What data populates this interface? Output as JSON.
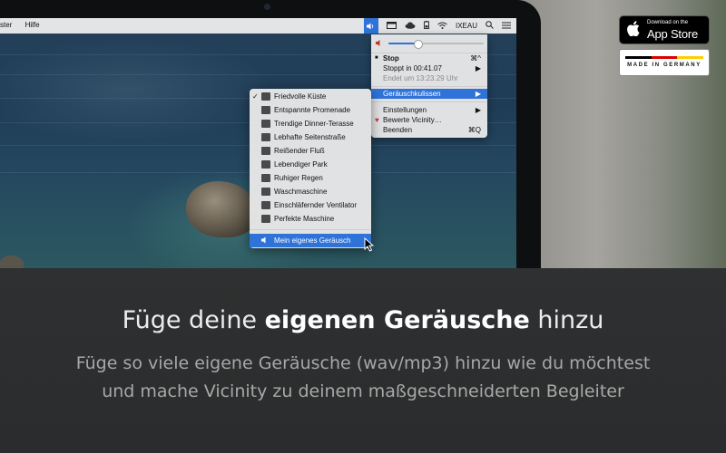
{
  "menubar": {
    "left_items": [
      "ster",
      "Hilfe"
    ],
    "account_label": "IXEAU"
  },
  "app_menu": {
    "volume_percent": 30,
    "stop_label": "Stop",
    "stop_shortcut": "⌘^",
    "stopped_label": "Stoppt in 00:41.07",
    "ends_label": "Endet um 13:23.29 Uhr",
    "sounds_label": "Geräuschkulissen",
    "settings_label": "Einstellungen",
    "rate_label": "Bewerte Vicinity…",
    "quit_label": "Beenden",
    "quit_shortcut": "⌘Q",
    "submenu_arrow": "▶"
  },
  "sounds_submenu": {
    "items": [
      {
        "label": "Friedvolle Küste",
        "checked": true
      },
      {
        "label": "Entspannte Promenade",
        "checked": false
      },
      {
        "label": "Trendige Dinner-Terasse",
        "checked": false
      },
      {
        "label": "Lebhafte Seitenstraße",
        "checked": false
      },
      {
        "label": "Reißender Fluß",
        "checked": false
      },
      {
        "label": "Lebendiger Park",
        "checked": false
      },
      {
        "label": "Ruhiger Regen",
        "checked": false
      },
      {
        "label": "Waschmaschine",
        "checked": false
      },
      {
        "label": "Einschläfernder Ventilator",
        "checked": false
      },
      {
        "label": "Perfekte Maschine",
        "checked": false
      }
    ],
    "custom_label": "Mein eigenes Geräusch",
    "check_glyph": "✓"
  },
  "badges": {
    "appstore_small": "Download on the",
    "appstore_large": "App Store",
    "germany": "MADE IN GERMANY",
    "flag_colors": [
      "#000000",
      "#dd0000",
      "#ffce00"
    ]
  },
  "caption": {
    "headline_pre": "Füge deine ",
    "headline_bold": "eigenen Geräusche",
    "headline_post": " hinzu",
    "line1": "Füge so viele eigene Geräusche (wav/mp3) hinzu wie du möchtest",
    "line2": "und mache Vicinity zu deinem maßgeschneiderten Begleiter"
  },
  "colors": {
    "accent": "#2f73d9"
  },
  "icons": {
    "menubar": [
      "speaker-icon",
      "window-icon",
      "cloud-icon",
      "battery-icon",
      "wifi-icon",
      "search-icon",
      "list-icon"
    ],
    "submenu": [
      "beach-icon",
      "promenade-icon",
      "dinner-icon",
      "street-icon",
      "river-icon",
      "park-icon",
      "rain-icon",
      "washer-icon",
      "fan-icon",
      "machine-icon",
      "speaker-icon"
    ]
  }
}
